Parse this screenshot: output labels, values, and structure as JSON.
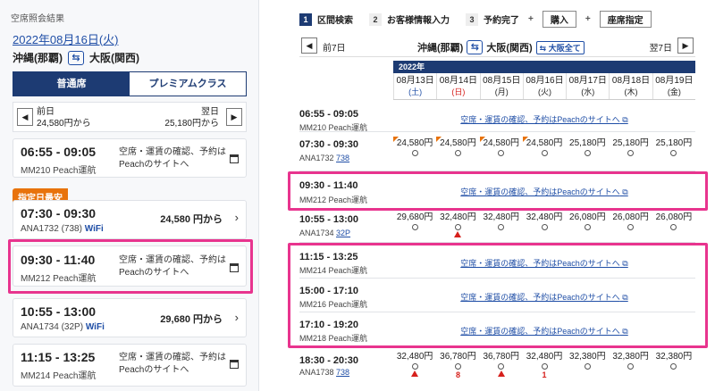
{
  "left": {
    "section_title": "空席照会結果",
    "date": "2022年08月16日(火)",
    "origin": "沖縄(那覇)",
    "destination": "大阪(関西)",
    "tabs": [
      "普通席",
      "プレミアムクラス"
    ],
    "prev_day": {
      "label": "前日",
      "price": "24,580円から"
    },
    "next_day": {
      "label": "翌日",
      "price": "25,180円から"
    },
    "badge": "指定日最安",
    "flights": [
      {
        "time": "06:55 - 09:05",
        "flight": "MM210  Peach運航",
        "note": "空席・運賃の確認、予約は Peachのサイトへ"
      },
      {
        "time": "07:30 - 09:30",
        "flight": "ANA1732",
        "equip": "(738)",
        "wifi": "WiFi",
        "price": "24,580 円から"
      },
      {
        "time": "09:30 - 11:40",
        "flight": "MM212  Peach運航",
        "note": "空席・運賃の確認、予約は Peachのサイトへ"
      },
      {
        "time": "10:55 - 13:00",
        "flight": "ANA1734",
        "equip": "(32P)",
        "wifi": "WiFi",
        "price": "29,680 円から"
      },
      {
        "time": "11:15 - 13:25",
        "flight": "MM214  Peach運航",
        "note": "空席・運賃の確認、予約は Peachのサイトへ"
      }
    ]
  },
  "right": {
    "steps": [
      {
        "num": "1",
        "label": "区間検索"
      },
      {
        "num": "2",
        "label": "お客様情報入力"
      },
      {
        "num": "3",
        "label": "予約完了"
      }
    ],
    "buy_label": "購入",
    "seat_label": "座席指定",
    "prev7": "前7日",
    "next7": "翌7日",
    "origin": "沖縄(那覇)",
    "destination": "大阪(関西)",
    "all_osaka": "大阪全て",
    "year": "2022年",
    "dates": [
      {
        "d": "08月13日",
        "w": "(土)"
      },
      {
        "d": "08月14日",
        "w": "(日)"
      },
      {
        "d": "08月15日",
        "w": "(月)"
      },
      {
        "d": "08月16日",
        "w": "(火)"
      },
      {
        "d": "08月17日",
        "w": "(水)"
      },
      {
        "d": "08月18日",
        "w": "(木)"
      },
      {
        "d": "08月19日",
        "w": "(金)"
      }
    ],
    "peach_link": "空席・運賃の確認、予約はPeachのサイトへ",
    "rows": [
      {
        "time": "06:55 - 09:05",
        "flight": "MM210  Peach運航"
      },
      {
        "time": "07:30 - 09:30",
        "flight": "ANA1732",
        "equip": "738",
        "prices": [
          "24,580円",
          "24,580円",
          "24,580円",
          "24,580円",
          "25,180円",
          "25,180円",
          "25,180円"
        ]
      },
      {
        "time": "09:30 - 11:40",
        "flight": "MM212  Peach運航"
      },
      {
        "time": "10:55 - 13:00",
        "flight": "ANA1734",
        "equip": "32P",
        "prices": [
          "29,680円",
          "32,480円",
          "32,480円",
          "32,480円",
          "26,080円",
          "26,080円",
          "26,080円"
        ]
      },
      {
        "time": "11:15 - 13:25",
        "flight": "MM214  Peach運航"
      },
      {
        "time": "15:00 - 17:10",
        "flight": "MM216  Peach運航"
      },
      {
        "time": "17:10 - 19:20",
        "flight": "MM218  Peach運航"
      },
      {
        "time": "18:30 - 20:30",
        "flight": "ANA1738",
        "equip": "738",
        "prices": [
          "32,480円",
          "36,780円",
          "36,780円",
          "32,480円",
          "32,380円",
          "32,380円",
          "32,380円"
        ],
        "seats_left": [
          "",
          "8",
          "",
          "1",
          "",
          "",
          ""
        ]
      }
    ]
  },
  "colors": {
    "navy": "#1d3b73",
    "highlight": "#e8348e",
    "orange": "#e8730c",
    "link": "#1f4ea6"
  }
}
